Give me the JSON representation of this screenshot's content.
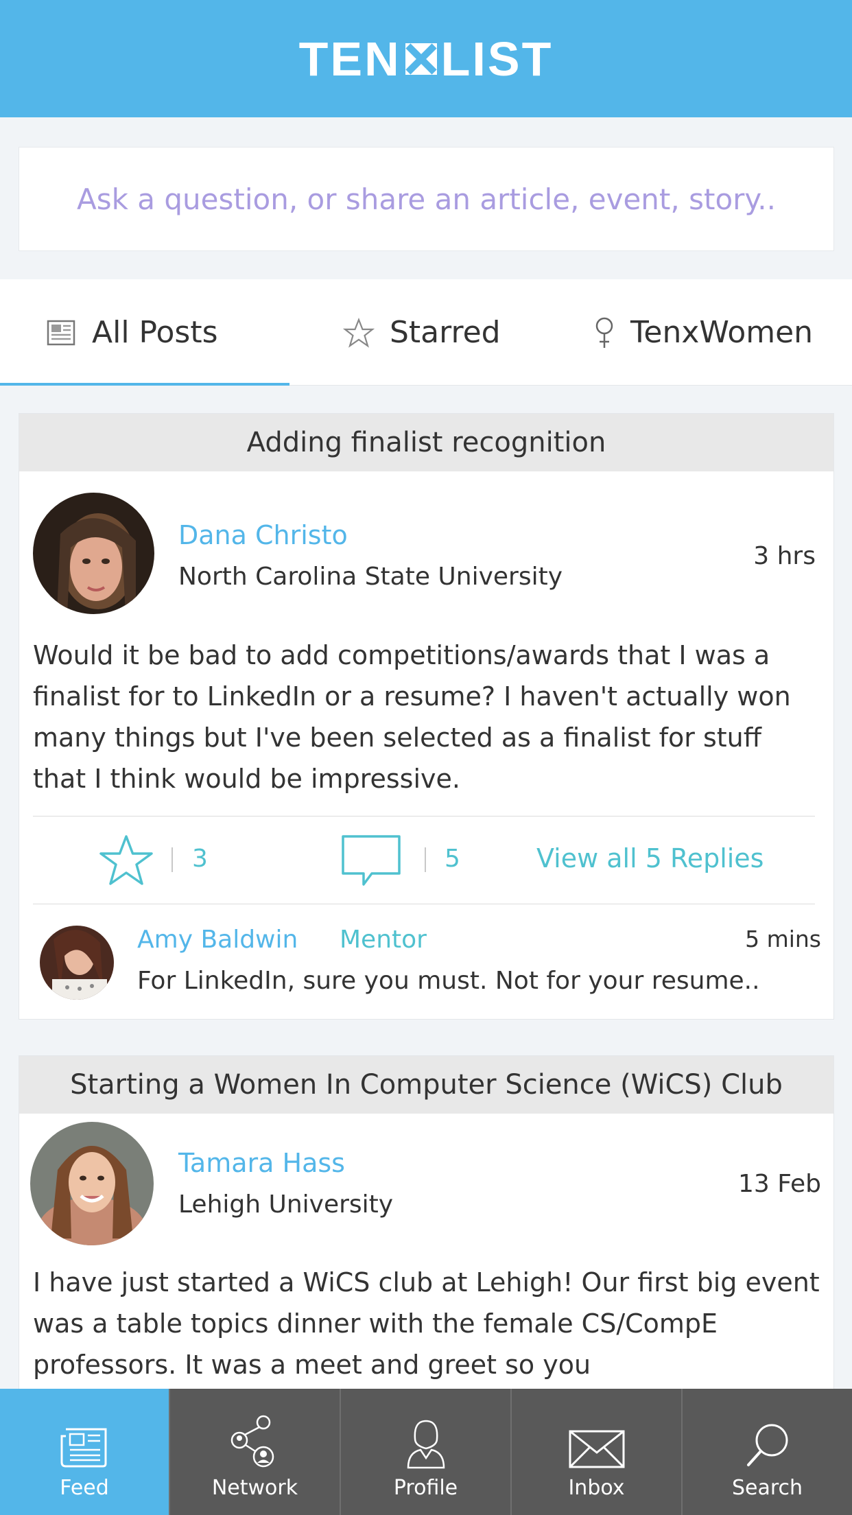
{
  "header": {
    "logo_left": "TEN",
    "logo_right": "LIST"
  },
  "compose": {
    "placeholder": "Ask a question, or share an article, event, story.."
  },
  "tabs": [
    {
      "label": "All Posts",
      "icon": "newspaper-icon",
      "active": true
    },
    {
      "label": "Starred",
      "icon": "star-outline-icon",
      "active": false
    },
    {
      "label": "TenxWomen",
      "icon": "female-symbol-icon",
      "active": false
    }
  ],
  "posts": [
    {
      "title": "Adding finalist recognition",
      "author": {
        "name": "Dana Christo",
        "school": "North Carolina State University"
      },
      "time": "3 hrs",
      "body": "Would it be bad to add competitions/awards that I was a finalist for to LinkedIn or a resume? I haven't actually won many things but I've been selected as a finalist for stuff that I think would be impressive.",
      "stars": "3",
      "comments": "5",
      "view_replies": "View all 5 Replies",
      "reply": {
        "name": "Amy Baldwin",
        "role": "Mentor",
        "time": "5 mins",
        "text": "For LinkedIn, sure you must. Not for your resume.."
      }
    },
    {
      "title": "Starting a Women In Computer Science (WiCS) Club",
      "author": {
        "name": "Tamara Hass",
        "school": "Lehigh University"
      },
      "time": "13 Feb",
      "body": "I have just started a WiCS club at Lehigh! Our first big event was a table topics dinner with the female CS/CompE professors. It was a meet and greet so you"
    }
  ],
  "nav": [
    {
      "label": "Feed",
      "icon": "newspaper-icon",
      "active": true
    },
    {
      "label": "Network",
      "icon": "network-icon",
      "active": false
    },
    {
      "label": "Profile",
      "icon": "person-icon",
      "active": false
    },
    {
      "label": "Inbox",
      "icon": "envelope-icon",
      "active": false
    },
    {
      "label": "Search",
      "icon": "search-icon",
      "active": false
    }
  ],
  "colors": {
    "brand": "#53b6e9",
    "accent_teal": "#4fc1cf",
    "placeholder": "#a99ce0",
    "nav_bg": "#595959"
  }
}
